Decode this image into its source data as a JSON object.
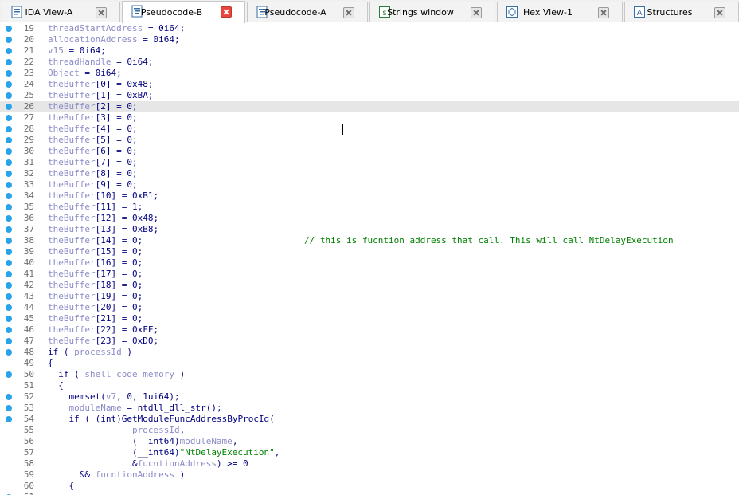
{
  "tabs": [
    {
      "label": "IDA View-A",
      "icon": "ida-view-icon",
      "active": false
    },
    {
      "label": "Pseudocode-B",
      "icon": "pseudocode-icon",
      "active": true
    },
    {
      "label": "Pseudocode-A",
      "icon": "pseudocode-icon",
      "active": false
    },
    {
      "label": "Strings window",
      "icon": "strings-icon",
      "active": false
    },
    {
      "label": "Hex View-1",
      "icon": "hex-icon",
      "active": false
    },
    {
      "label": "Structures",
      "icon": "structures-icon",
      "active": false
    }
  ],
  "colors": {
    "dot": "#29a3ea",
    "keyword": "#000080",
    "variable": "#8c8cc8",
    "string": "#008000",
    "active_close": "#e8453c"
  },
  "lines": [
    {
      "n": "19",
      "dot": true,
      "text": "threadStartAddress = 0i64;"
    },
    {
      "n": "20",
      "dot": true,
      "text": "allocationAddress = 0i64;"
    },
    {
      "n": "21",
      "dot": true,
      "text": "v15 = 0i64;"
    },
    {
      "n": "22",
      "dot": true,
      "text": "threadHandle = 0i64;"
    },
    {
      "n": "23",
      "dot": true,
      "text": "Object = 0i64;"
    },
    {
      "n": "24",
      "dot": true,
      "text": "theBuffer[0] = 0x48;"
    },
    {
      "n": "25",
      "dot": true,
      "text": "theBuffer[1] = 0xBA;"
    },
    {
      "n": "26",
      "dot": true,
      "text": "theBuffer[2] = 0;"
    },
    {
      "n": "27",
      "dot": true,
      "text": "theBuffer[3] = 0;"
    },
    {
      "n": "28",
      "dot": true,
      "text": "theBuffer[4] = 0;"
    },
    {
      "n": "29",
      "dot": true,
      "text": "theBuffer[5] = 0;"
    },
    {
      "n": "30",
      "dot": true,
      "text": "theBuffer[6] = 0;"
    },
    {
      "n": "31",
      "dot": true,
      "text": "theBuffer[7] = 0;"
    },
    {
      "n": "32",
      "dot": true,
      "text": "theBuffer[8] = 0;"
    },
    {
      "n": "33",
      "dot": true,
      "text": "theBuffer[9] = 0;"
    },
    {
      "n": "34",
      "dot": true,
      "text": "theBuffer[10] = 0xB1;"
    },
    {
      "n": "35",
      "dot": true,
      "text": "theBuffer[11] = 1;"
    },
    {
      "n": "36",
      "dot": true,
      "text": "theBuffer[12] = 0x48;"
    },
    {
      "n": "37",
      "dot": true,
      "text": "theBuffer[13] = 0xB8;"
    },
    {
      "n": "38",
      "dot": true,
      "text": "theBuffer[14] = 0;",
      "comment": "// this is fucntion address that call. This will call NtDelayExecution"
    },
    {
      "n": "39",
      "dot": true,
      "text": "theBuffer[15] = 0;"
    },
    {
      "n": "40",
      "dot": true,
      "text": "theBuffer[16] = 0;"
    },
    {
      "n": "41",
      "dot": true,
      "text": "theBuffer[17] = 0;"
    },
    {
      "n": "42",
      "dot": true,
      "text": "theBuffer[18] = 0;"
    },
    {
      "n": "43",
      "dot": true,
      "text": "theBuffer[19] = 0;"
    },
    {
      "n": "44",
      "dot": true,
      "text": "theBuffer[20] = 0;"
    },
    {
      "n": "45",
      "dot": true,
      "text": "theBuffer[21] = 0;"
    },
    {
      "n": "46",
      "dot": true,
      "text": "theBuffer[22] = 0xFF;"
    },
    {
      "n": "47",
      "dot": true,
      "text": "theBuffer[23] = 0xD0;"
    },
    {
      "n": "48",
      "dot": true,
      "text": "if ( processId )"
    },
    {
      "n": "49",
      "dot": false,
      "text": "{"
    },
    {
      "n": "50",
      "dot": true,
      "text": "  if ( shell_code_memory )"
    },
    {
      "n": "51",
      "dot": false,
      "text": "  {"
    },
    {
      "n": "52",
      "dot": true,
      "text": "    memset(v7, 0, 1ui64);"
    },
    {
      "n": "53",
      "dot": true,
      "text": "    moduleName = ntdll_dll_str();"
    },
    {
      "n": "54",
      "dot": true,
      "text": "    if ( (int)GetModuleFuncAddressByProcId("
    },
    {
      "n": "55",
      "dot": false,
      "text": "                processId,"
    },
    {
      "n": "56",
      "dot": false,
      "text": "                (__int64)moduleName,"
    },
    {
      "n": "57",
      "dot": false,
      "text": "                (__int64)\"NtDelayExecution\","
    },
    {
      "n": "58",
      "dot": false,
      "text": "                &fucntionAddress) >= 0"
    },
    {
      "n": "59",
      "dot": false,
      "text": "      && fucntionAddress )"
    },
    {
      "n": "60",
      "dot": false,
      "text": "    {"
    },
    {
      "n": "61",
      "dot": true,
      "text": ""
    }
  ]
}
